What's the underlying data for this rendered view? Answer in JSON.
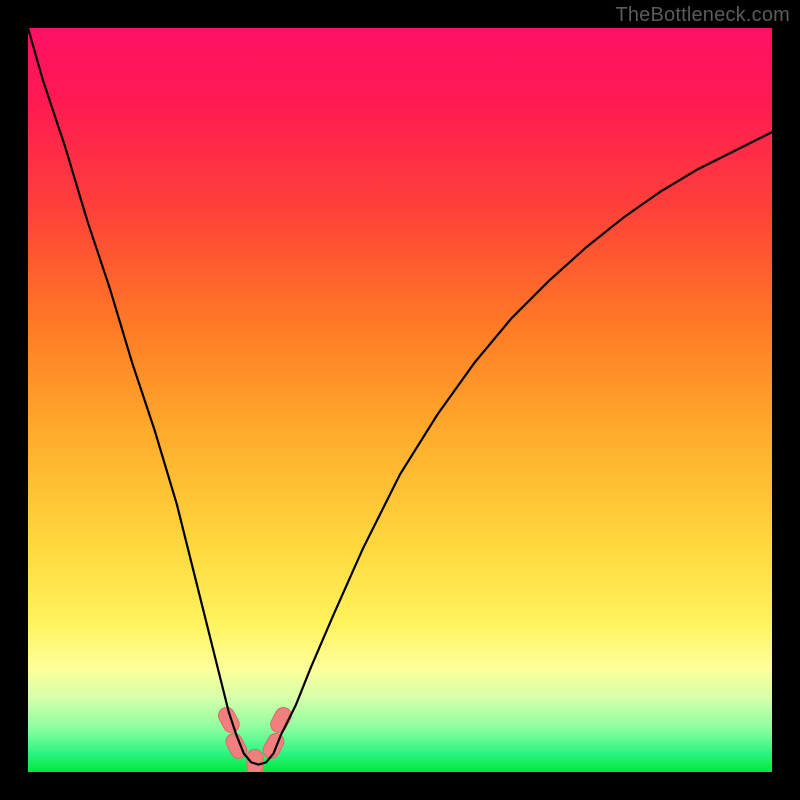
{
  "watermark": "TheBottleneck.com",
  "colors": {
    "black": "#000000",
    "curve": "#000000",
    "marker_fill": "#f08080",
    "marker_stroke": "#e06666",
    "green": "#00e83a",
    "greenlight": "#6cff6c",
    "yellowlight": "#ffff9a",
    "yellow": "#ffe34a",
    "orange": "#ff8a2a",
    "redorange": "#ff4d3c",
    "red": "#ff1450",
    "magenta": "#ff1065"
  },
  "chart_data": {
    "type": "line",
    "title": "",
    "xlabel": "",
    "ylabel": "",
    "xlim": [
      0,
      100
    ],
    "ylim": [
      0,
      100
    ],
    "x": [
      0,
      2,
      5,
      8,
      11,
      14,
      17,
      20,
      22,
      24,
      26,
      27,
      28,
      29,
      30,
      31,
      32,
      33,
      34,
      36,
      38,
      41,
      45,
      50,
      55,
      60,
      65,
      70,
      75,
      80,
      85,
      90,
      95,
      100
    ],
    "values": [
      100,
      93,
      84,
      74,
      65,
      55,
      46,
      36,
      28,
      20,
      12,
      8,
      5,
      2.5,
      1.3,
      1.0,
      1.3,
      2.5,
      5,
      9,
      14,
      21,
      30,
      40,
      48,
      55,
      61,
      66,
      70.5,
      74.5,
      78,
      81,
      83.5,
      86
    ],
    "markers": [
      {
        "x": 27.0,
        "y": 7.0
      },
      {
        "x": 28.0,
        "y": 3.5
      },
      {
        "x": 30.5,
        "y": 1.3
      },
      {
        "x": 33.0,
        "y": 3.5
      },
      {
        "x": 34.0,
        "y": 7.0
      }
    ],
    "marker_shape": "rounded-rect"
  }
}
